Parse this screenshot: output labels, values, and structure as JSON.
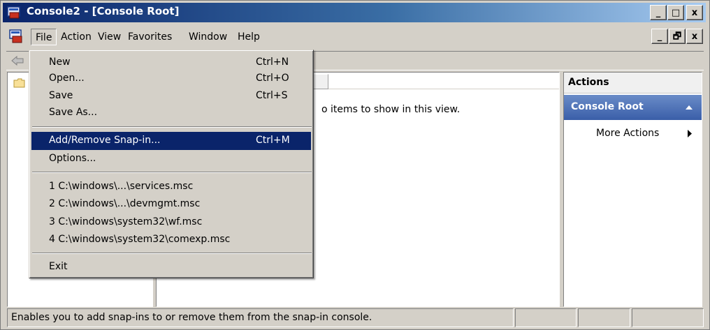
{
  "window": {
    "title": "Console2 - [Console Root]"
  },
  "caption_buttons": {
    "minimize": "_",
    "maximize": "□",
    "close": "x"
  },
  "mdi_buttons": {
    "minimize": "_",
    "restore": "🗗",
    "close": "x"
  },
  "menubar": {
    "items": [
      "File",
      "Action",
      "View",
      "Favorites",
      "Window",
      "Help"
    ]
  },
  "file_menu": {
    "items": [
      {
        "label": "New",
        "shortcut": "Ctrl+N"
      },
      {
        "label": "Open...",
        "shortcut": "Ctrl+O"
      },
      {
        "label": "Save",
        "shortcut": "Ctrl+S"
      },
      {
        "label": "Save As...",
        "shortcut": ""
      },
      {
        "label": "Add/Remove Snap-in...",
        "shortcut": "Ctrl+M",
        "highlighted": true
      },
      {
        "label": "Options...",
        "shortcut": ""
      },
      {
        "label": "1 C:\\windows\\...\\services.msc",
        "shortcut": ""
      },
      {
        "label": "2 C:\\windows\\...\\devmgmt.msc",
        "shortcut": ""
      },
      {
        "label": "3 C:\\windows\\system32\\wf.msc",
        "shortcut": ""
      },
      {
        "label": "4 C:\\windows\\system32\\comexp.msc",
        "shortcut": ""
      },
      {
        "label": "Exit",
        "shortcut": ""
      }
    ]
  },
  "result_pane": {
    "empty_message": "o items to show in this view."
  },
  "actions_pane": {
    "title": "Actions",
    "section": "Console Root",
    "more_actions": "More Actions"
  },
  "statusbar": {
    "text": "Enables you to add snap-ins to or remove them from the snap-in console."
  },
  "icons": [
    "console-app-icon",
    "back-arrow-icon",
    "folder-icon",
    "collapse-up-icon",
    "submenu-arrow-icon"
  ],
  "colors": {
    "title_gradient_start": "#0a246a",
    "menu_highlight": "#0a246a",
    "actions_header": "#3a5ea8"
  }
}
